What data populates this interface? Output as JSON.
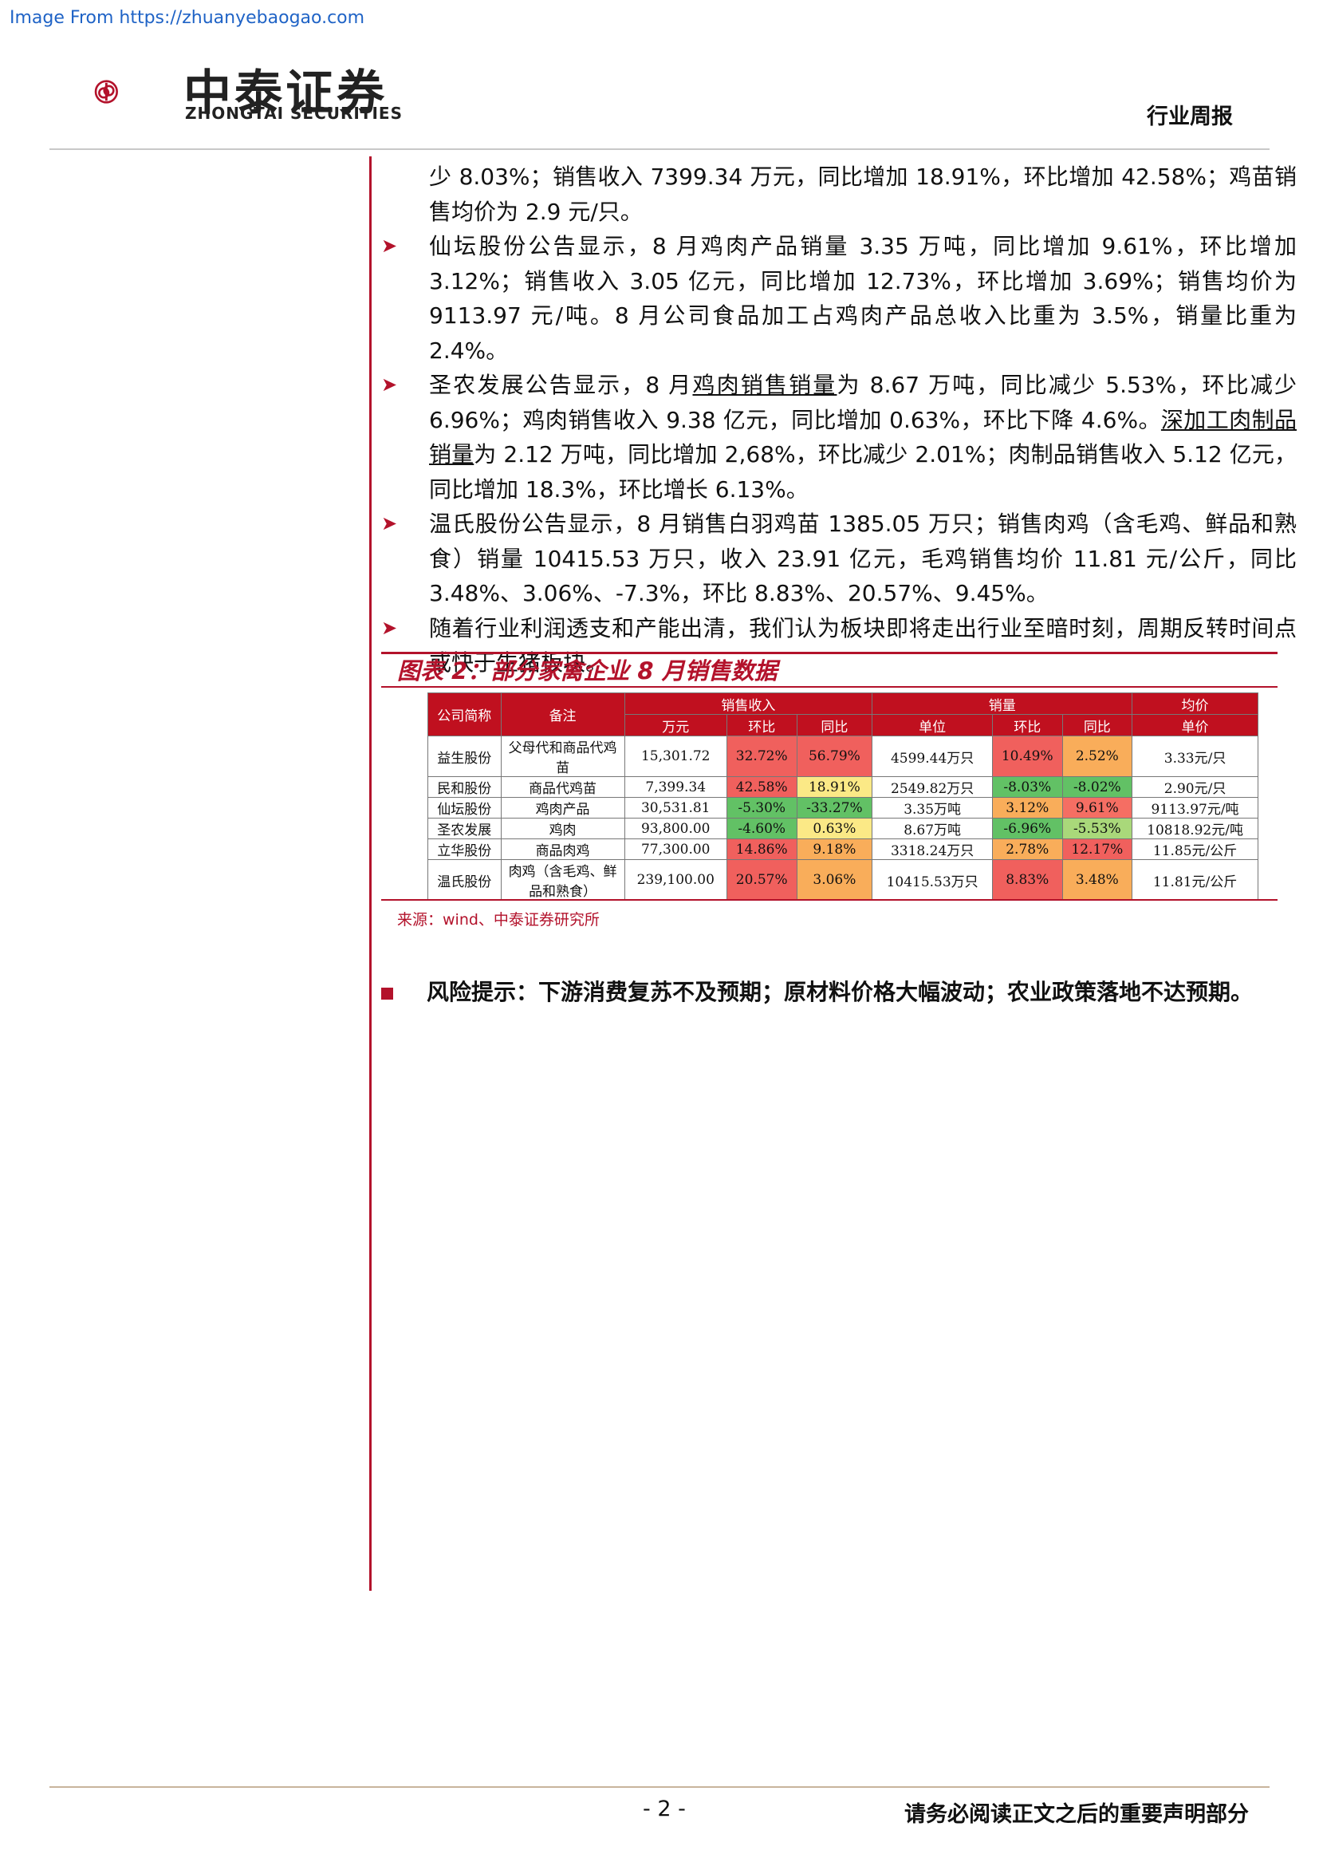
{
  "watermark": "Image From https://zhuanyebaogao.com",
  "brand": {
    "name_cn": "中泰证券",
    "name_en": "ZHONGTAI SECURITIES",
    "accent": "#b3122b"
  },
  "report_type": "行业周报",
  "paragraphs": [
    {
      "bullet": "",
      "text": "少 8.03%；销售收入 7399.34 万元，同比增加 18.91%，环比增加 42.58%；鸡苗销售均价为 2.9 元/只。"
    },
    {
      "bullet": "➤",
      "text": "仙坛股份公告显示，8 月鸡肉产品销量 3.35 万吨，同比增加 9.61%，环比增加 3.12%；销售收入 3.05 亿元，同比增加 12.73%，环比增加 3.69%；销售均价为 9113.97 元/吨。8 月公司食品加工占鸡肉产品总收入比重为 3.5%，销量比重为 2.4%。"
    },
    {
      "bullet": "➤",
      "parts": [
        "圣农发展公告显示，8 月",
        "鸡肉销售销量",
        "为 8.67 万吨，同比减少 5.53%，环比减少 6.96%；鸡肉销售收入 9.38 亿元，同比增加 0.63%，环比下降 4.6%。",
        "深加工肉制品销量",
        "为 2.12 万吨，同比增加 2,68%，环比减少 2.01%；肉制品销售收入 5.12 亿元，同比增加 18.3%，环比增长 6.13%。"
      ]
    },
    {
      "bullet": "➤",
      "text": "温氏股份公告显示，8 月销售白羽鸡苗 1385.05 万只；销售肉鸡（含毛鸡、鲜品和熟食）销量 10415.53 万只，收入 23.91 亿元，毛鸡销售均价 11.81 元/公斤，同比 3.48%、3.06%、-7.3%，环比 8.83%、20.57%、9.45%。"
    },
    {
      "bullet": "➤",
      "text": "随着行业利润透支和产能出清，我们认为板块即将走出行业至暗时刻，周期反转时间点或快于生猪板块。"
    }
  ],
  "figure": {
    "title": "图表 2：部分家禽企业 8 月销售数据",
    "headers": {
      "company": "公司简称",
      "note": "备注",
      "revenue": "销售收入",
      "volume": "销量",
      "price": "均价",
      "rev_unit": "万元",
      "rev_qoq": "环比",
      "rev_yoy": "同比",
      "vol_unit": "单位",
      "vol_qoq": "环比",
      "vol_yoy": "同比",
      "price_unit": "单价"
    },
    "rows": [
      {
        "company": "益生股份",
        "note": "父母代和商品代鸡苗",
        "revenue": "15,301.72",
        "rev_qoq": "32.72%",
        "rev_yoy": "56.79%",
        "volume": "4599.44万只",
        "vol_qoq": "10.49%",
        "vol_yoy": "2.52%",
        "price": "3.33元/只"
      },
      {
        "company": "民和股份",
        "note": "商品代鸡苗",
        "revenue": "7,399.34",
        "rev_qoq": "42.58%",
        "rev_yoy": "18.91%",
        "volume": "2549.82万只",
        "vol_qoq": "-8.03%",
        "vol_yoy": "-8.02%",
        "price": "2.90元/只"
      },
      {
        "company": "仙坛股份",
        "note": "鸡肉产品",
        "revenue": "30,531.81",
        "rev_qoq": "-5.30%",
        "rev_yoy": "-33.27%",
        "volume": "3.35万吨",
        "vol_qoq": "3.12%",
        "vol_yoy": "9.61%",
        "price": "9113.97元/吨"
      },
      {
        "company": "圣农发展",
        "note": "鸡肉",
        "revenue": "93,800.00",
        "rev_qoq": "-4.60%",
        "rev_yoy": "0.63%",
        "volume": "8.67万吨",
        "vol_qoq": "-6.96%",
        "vol_yoy": "-5.53%",
        "price": "10818.92元/吨"
      },
      {
        "company": "立华股份",
        "note": "商品肉鸡",
        "revenue": "77,300.00",
        "rev_qoq": "14.86%",
        "rev_yoy": "9.18%",
        "volume": "3318.24万只",
        "vol_qoq": "2.78%",
        "vol_yoy": "12.17%",
        "price": "11.85元/公斤"
      },
      {
        "company": "温氏股份",
        "note": "肉鸡（含毛鸡、鲜品和熟食）",
        "revenue": "239,100.00",
        "rev_qoq": "20.57%",
        "rev_yoy": "3.06%",
        "volume": "10415.53万只",
        "vol_qoq": "8.83%",
        "vol_yoy": "3.48%",
        "price": "11.81元/公斤"
      }
    ],
    "source": "来源：wind、中泰证券研究所"
  },
  "risk": "风险提示：下游消费复苏不及预期；原材料价格大幅波动；农业政策落地不达预期。",
  "footer": {
    "page": "- 2 -",
    "disclaimer": "请务必阅读正文之后的重要声明部分"
  }
}
